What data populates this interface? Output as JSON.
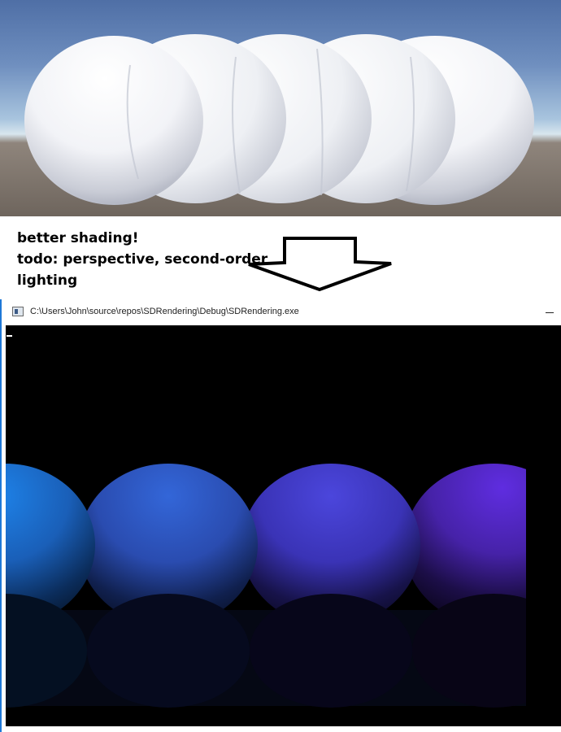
{
  "annotation": {
    "line1": "better shading!",
    "line2": "todo: perspective, second-order",
    "line3": "lighting"
  },
  "console": {
    "title": "C:\\Users\\John\\source\\repos\\SDRendering\\Debug\\SDRendering.exe"
  },
  "colors": {
    "window_accent": "#1e78d7",
    "sphere_cyan_blue": "#1a6fd6",
    "sphere_blue": "#2c5fd0",
    "sphere_indigo": "#4a3fd8",
    "sphere_violet": "#5a2ad8"
  },
  "icons": [
    "app-console-icon",
    "minimize-icon",
    "down-arrow-icon"
  ]
}
